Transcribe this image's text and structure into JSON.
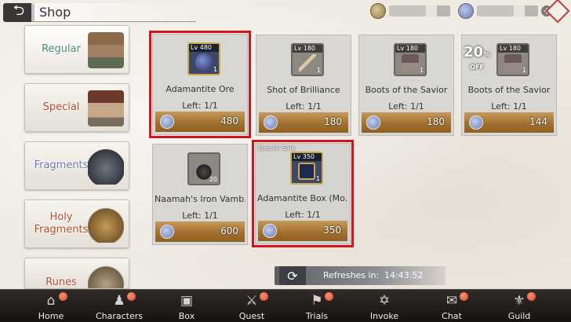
{
  "header": {
    "title": "Shop",
    "back_icon": "back-arrow-icon"
  },
  "tabs": [
    {
      "label": "Regular",
      "color": "#4d8a7b"
    },
    {
      "label": "Special",
      "color": "#b44d2a"
    },
    {
      "label": "Fragments",
      "color": "#6d7bb0"
    },
    {
      "label": "Holy Fragments",
      "color": "#b44d2a"
    },
    {
      "label": "Runes",
      "color": "#b44d2a"
    }
  ],
  "items": [
    {
      "level": "Lv 480",
      "qty": "1",
      "name": "Adamantite Ore",
      "left": "Left: 1/1",
      "price": "480"
    },
    {
      "level": "Lv 180",
      "qty": "1",
      "name": "Shot of Brilliance",
      "left": "Left: 1/1",
      "price": "180"
    },
    {
      "level": "Lv 180",
      "qty": "1",
      "name": "Boots of the Savior",
      "left": "Left: 1/1",
      "price": "180"
    },
    {
      "level": "Lv 180",
      "qty": "1",
      "name": "Boots of the Savior",
      "left": "Left: 1/1",
      "price": "144",
      "discount": "20",
      "discount_unit": "%",
      "discount_label": "OFF"
    },
    {
      "level": "",
      "qty": "20",
      "name": "Naamah's Iron Vamb...",
      "left": "Left: 1/1",
      "price": "600"
    },
    {
      "badge": "Special Sale",
      "level": "Lv 350",
      "qty": "1",
      "name": "Adamantite Box (Mo...",
      "left": "Left: 1/1",
      "price": "350"
    }
  ],
  "refresh": {
    "label": "Refreshes in:",
    "time": "14:43:52"
  },
  "nav": [
    {
      "label": "Home"
    },
    {
      "label": "Characters"
    },
    {
      "label": "Box"
    },
    {
      "label": "Quest"
    },
    {
      "label": "Trials"
    },
    {
      "label": "Invoke"
    },
    {
      "label": "Chat"
    },
    {
      "label": "Guild"
    }
  ],
  "colors": {
    "highlight": "#d4141c",
    "price_bar": "#a3712f",
    "nav_badge": "#d53a1a"
  }
}
